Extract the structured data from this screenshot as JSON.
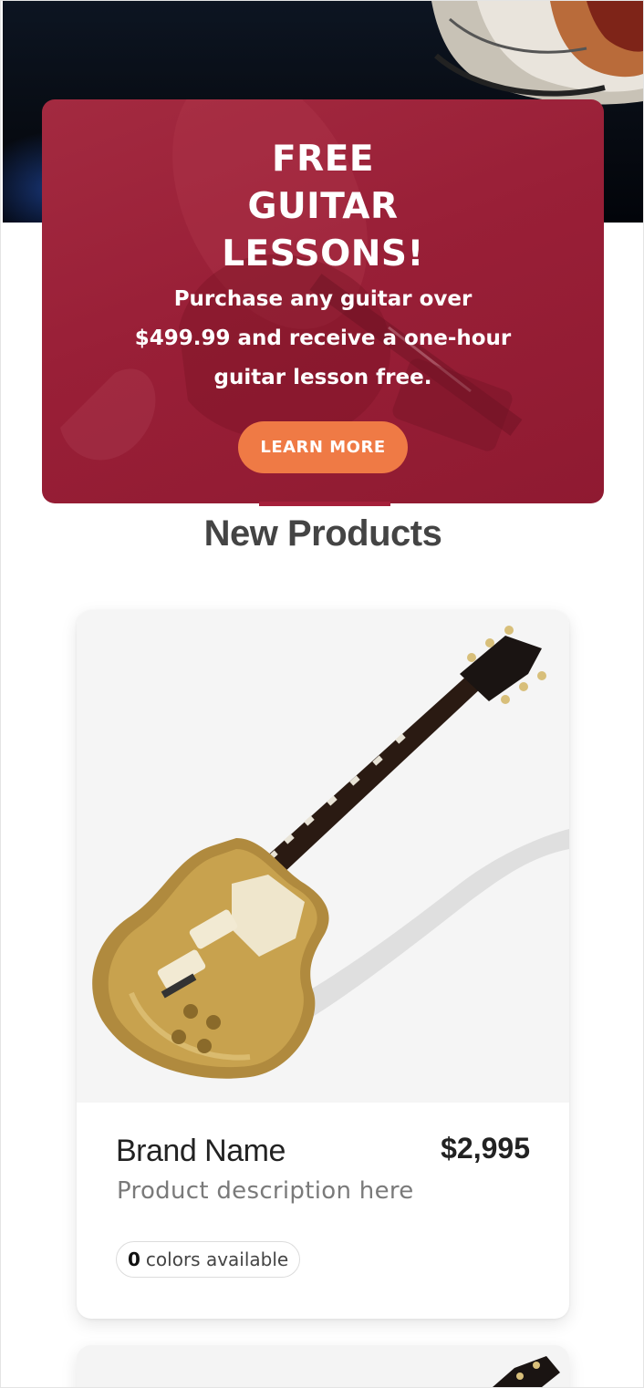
{
  "promo": {
    "title_lines": [
      "FREE",
      "GUITAR",
      "LESSONS!"
    ],
    "subtitle": "Purchase any guitar over $499.99 and receive a one-hour guitar lesson free.",
    "button_label": "LEARN MORE"
  },
  "section": {
    "title": "New Products"
  },
  "products": [
    {
      "brand": "Brand Name",
      "price": "$2,995",
      "description": "Product description here",
      "colors_count": "0",
      "colors_label": "colors available",
      "image_icon": "gold-electric-guitar-icon"
    }
  ],
  "colors": {
    "promo_bg": "#991f37",
    "button_bg": "#ef7a45",
    "accent_line": "#a5203a",
    "card_image_bg": "#f5f5f5"
  }
}
